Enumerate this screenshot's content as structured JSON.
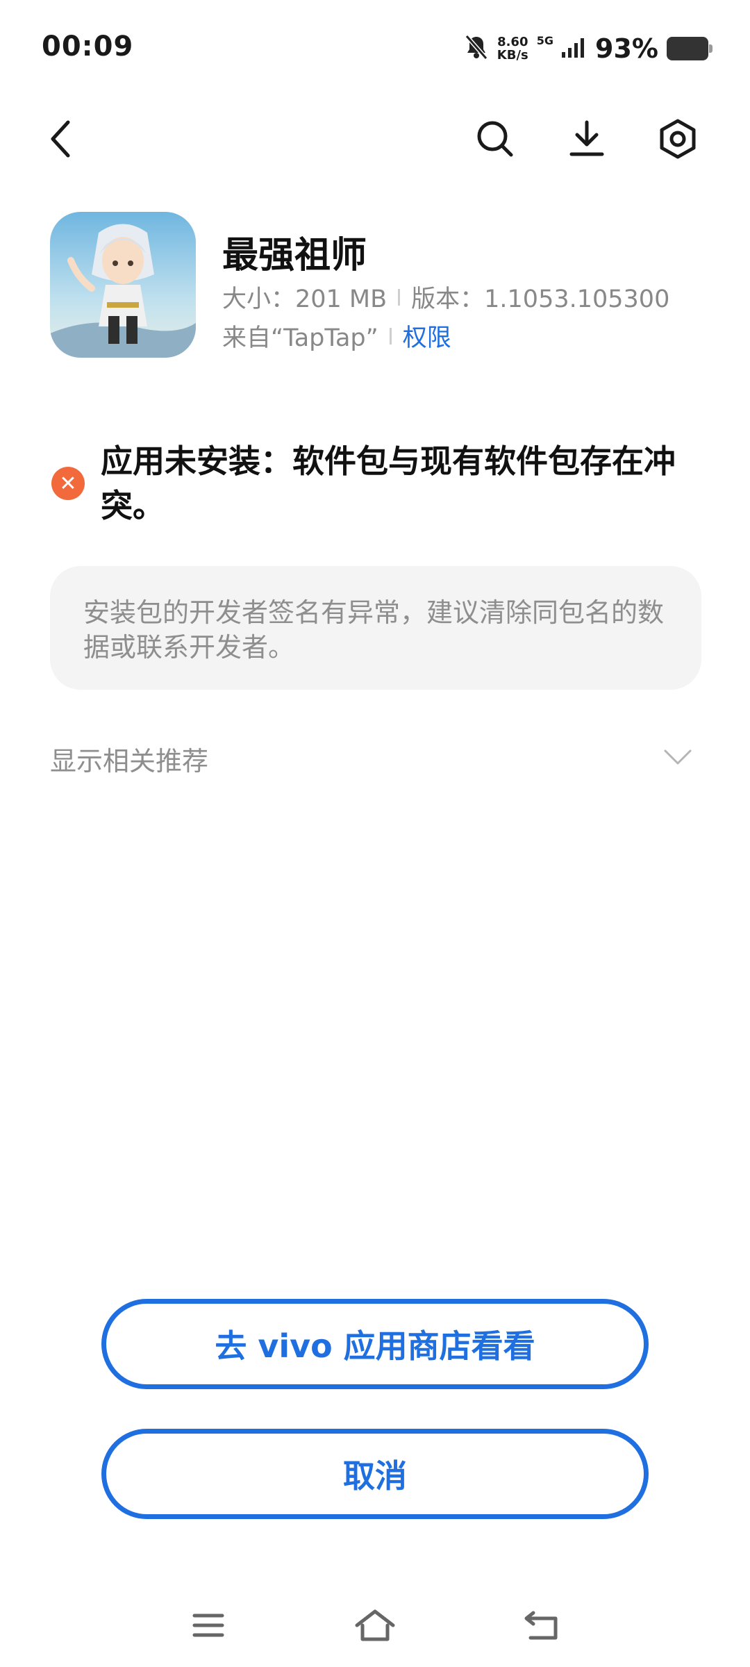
{
  "status_bar": {
    "time": "00:09",
    "net_speed_value": "8.60",
    "net_speed_unit": "KB/s",
    "network_type": "5G",
    "battery_percent": "93%",
    "battery_level": 0.93,
    "icons": [
      "bell-off-icon",
      "signal-icon",
      "battery-icon"
    ]
  },
  "toolbar": {
    "icons": [
      "back-icon",
      "search-icon",
      "download-icon",
      "settings-icon"
    ]
  },
  "app": {
    "name": "最强祖师",
    "size_label": "大小：201 MB",
    "version_label": "版本：1.1053.105300",
    "source_label": "来自“TapTap”",
    "permissions_link": "权限"
  },
  "error": {
    "icon": "error-x-icon",
    "message": "应用未安装：软件包与现有软件包存在冲突。"
  },
  "tip": {
    "text": "安装包的开发者签名有异常，建议清除同包名的数据或联系开发者。"
  },
  "recommendations": {
    "label": "显示相关推荐",
    "icon": "chevron-down-icon"
  },
  "actions": {
    "store_button": "去 vivo 应用商店看看",
    "cancel_button": "取消"
  },
  "nav_bar": {
    "icons": [
      "menu-icon",
      "home-icon",
      "back-nav-icon"
    ]
  },
  "colors": {
    "accent": "#1f6fe0",
    "error": "#f26a3c",
    "card_bg": "#f4f4f4",
    "muted_text": "#8e8e8e"
  }
}
